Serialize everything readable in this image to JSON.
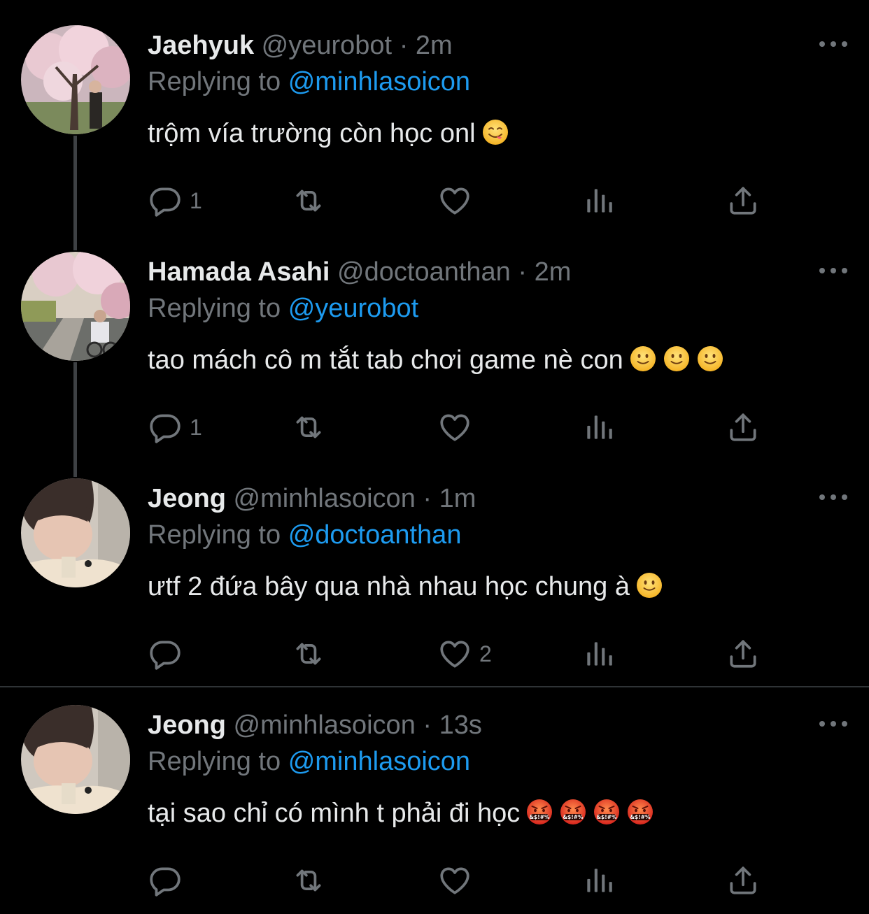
{
  "tweets": [
    {
      "name": "Jaehyuk",
      "handle": "@yeurobot",
      "dot": "·",
      "time": "2m",
      "replying_prefix": "Replying to",
      "replying_to": "@minhlasoicon",
      "text": "trộm vía trường còn học onl",
      "emoji": [
        "face-savoring-food"
      ],
      "reply_count": "1",
      "retweet_count": "",
      "like_count": "",
      "avatar": "cherry-blossom-photo"
    },
    {
      "name": "Hamada Asahi",
      "handle": "@doctoanthan",
      "dot": "·",
      "time": "2m",
      "replying_prefix": "Replying to",
      "replying_to": "@yeurobot",
      "text": "tao mách cô m tắt tab chơi game nè con",
      "emoji": [
        "slightly-smiling-face",
        "slightly-smiling-face",
        "slightly-smiling-face"
      ],
      "reply_count": "1",
      "retweet_count": "",
      "like_count": "",
      "avatar": "cherry-blossom-bike-photo"
    },
    {
      "name": "Jeong",
      "handle": "@minhlasoicon",
      "dot": "·",
      "time": "1m",
      "replying_prefix": "Replying to",
      "replying_to": "@doctoanthan",
      "text": "ưtf 2 đứa bây qua nhà nhau học chung à",
      "emoji": [
        "slightly-smiling-face"
      ],
      "reply_count": "",
      "retweet_count": "",
      "like_count": "2",
      "avatar": "selfie-photo"
    },
    {
      "name": "Jeong",
      "handle": "@minhlasoicon",
      "dot": "·",
      "time": "13s",
      "replying_prefix": "Replying to",
      "replying_to": "@minhlasoicon",
      "text": "tại sao chỉ có mình t phải đi học",
      "emoji": [
        "face-with-symbols-on-mouth",
        "face-with-symbols-on-mouth",
        "face-with-symbols-on-mouth",
        "face-with-symbols-on-mouth"
      ],
      "reply_count": "",
      "retweet_count": "",
      "like_count": "",
      "avatar": "selfie-photo"
    }
  ],
  "emoji_labels": {
    "symbols": "&$!#%"
  },
  "colors": {
    "background": "#000000",
    "text": "#e7e9ea",
    "muted": "#71767b",
    "link": "#1d9bf0",
    "thread_line": "#3e4144"
  },
  "icons": [
    "reply-icon",
    "retweet-icon",
    "like-icon",
    "views-icon",
    "share-icon",
    "more-icon"
  ]
}
